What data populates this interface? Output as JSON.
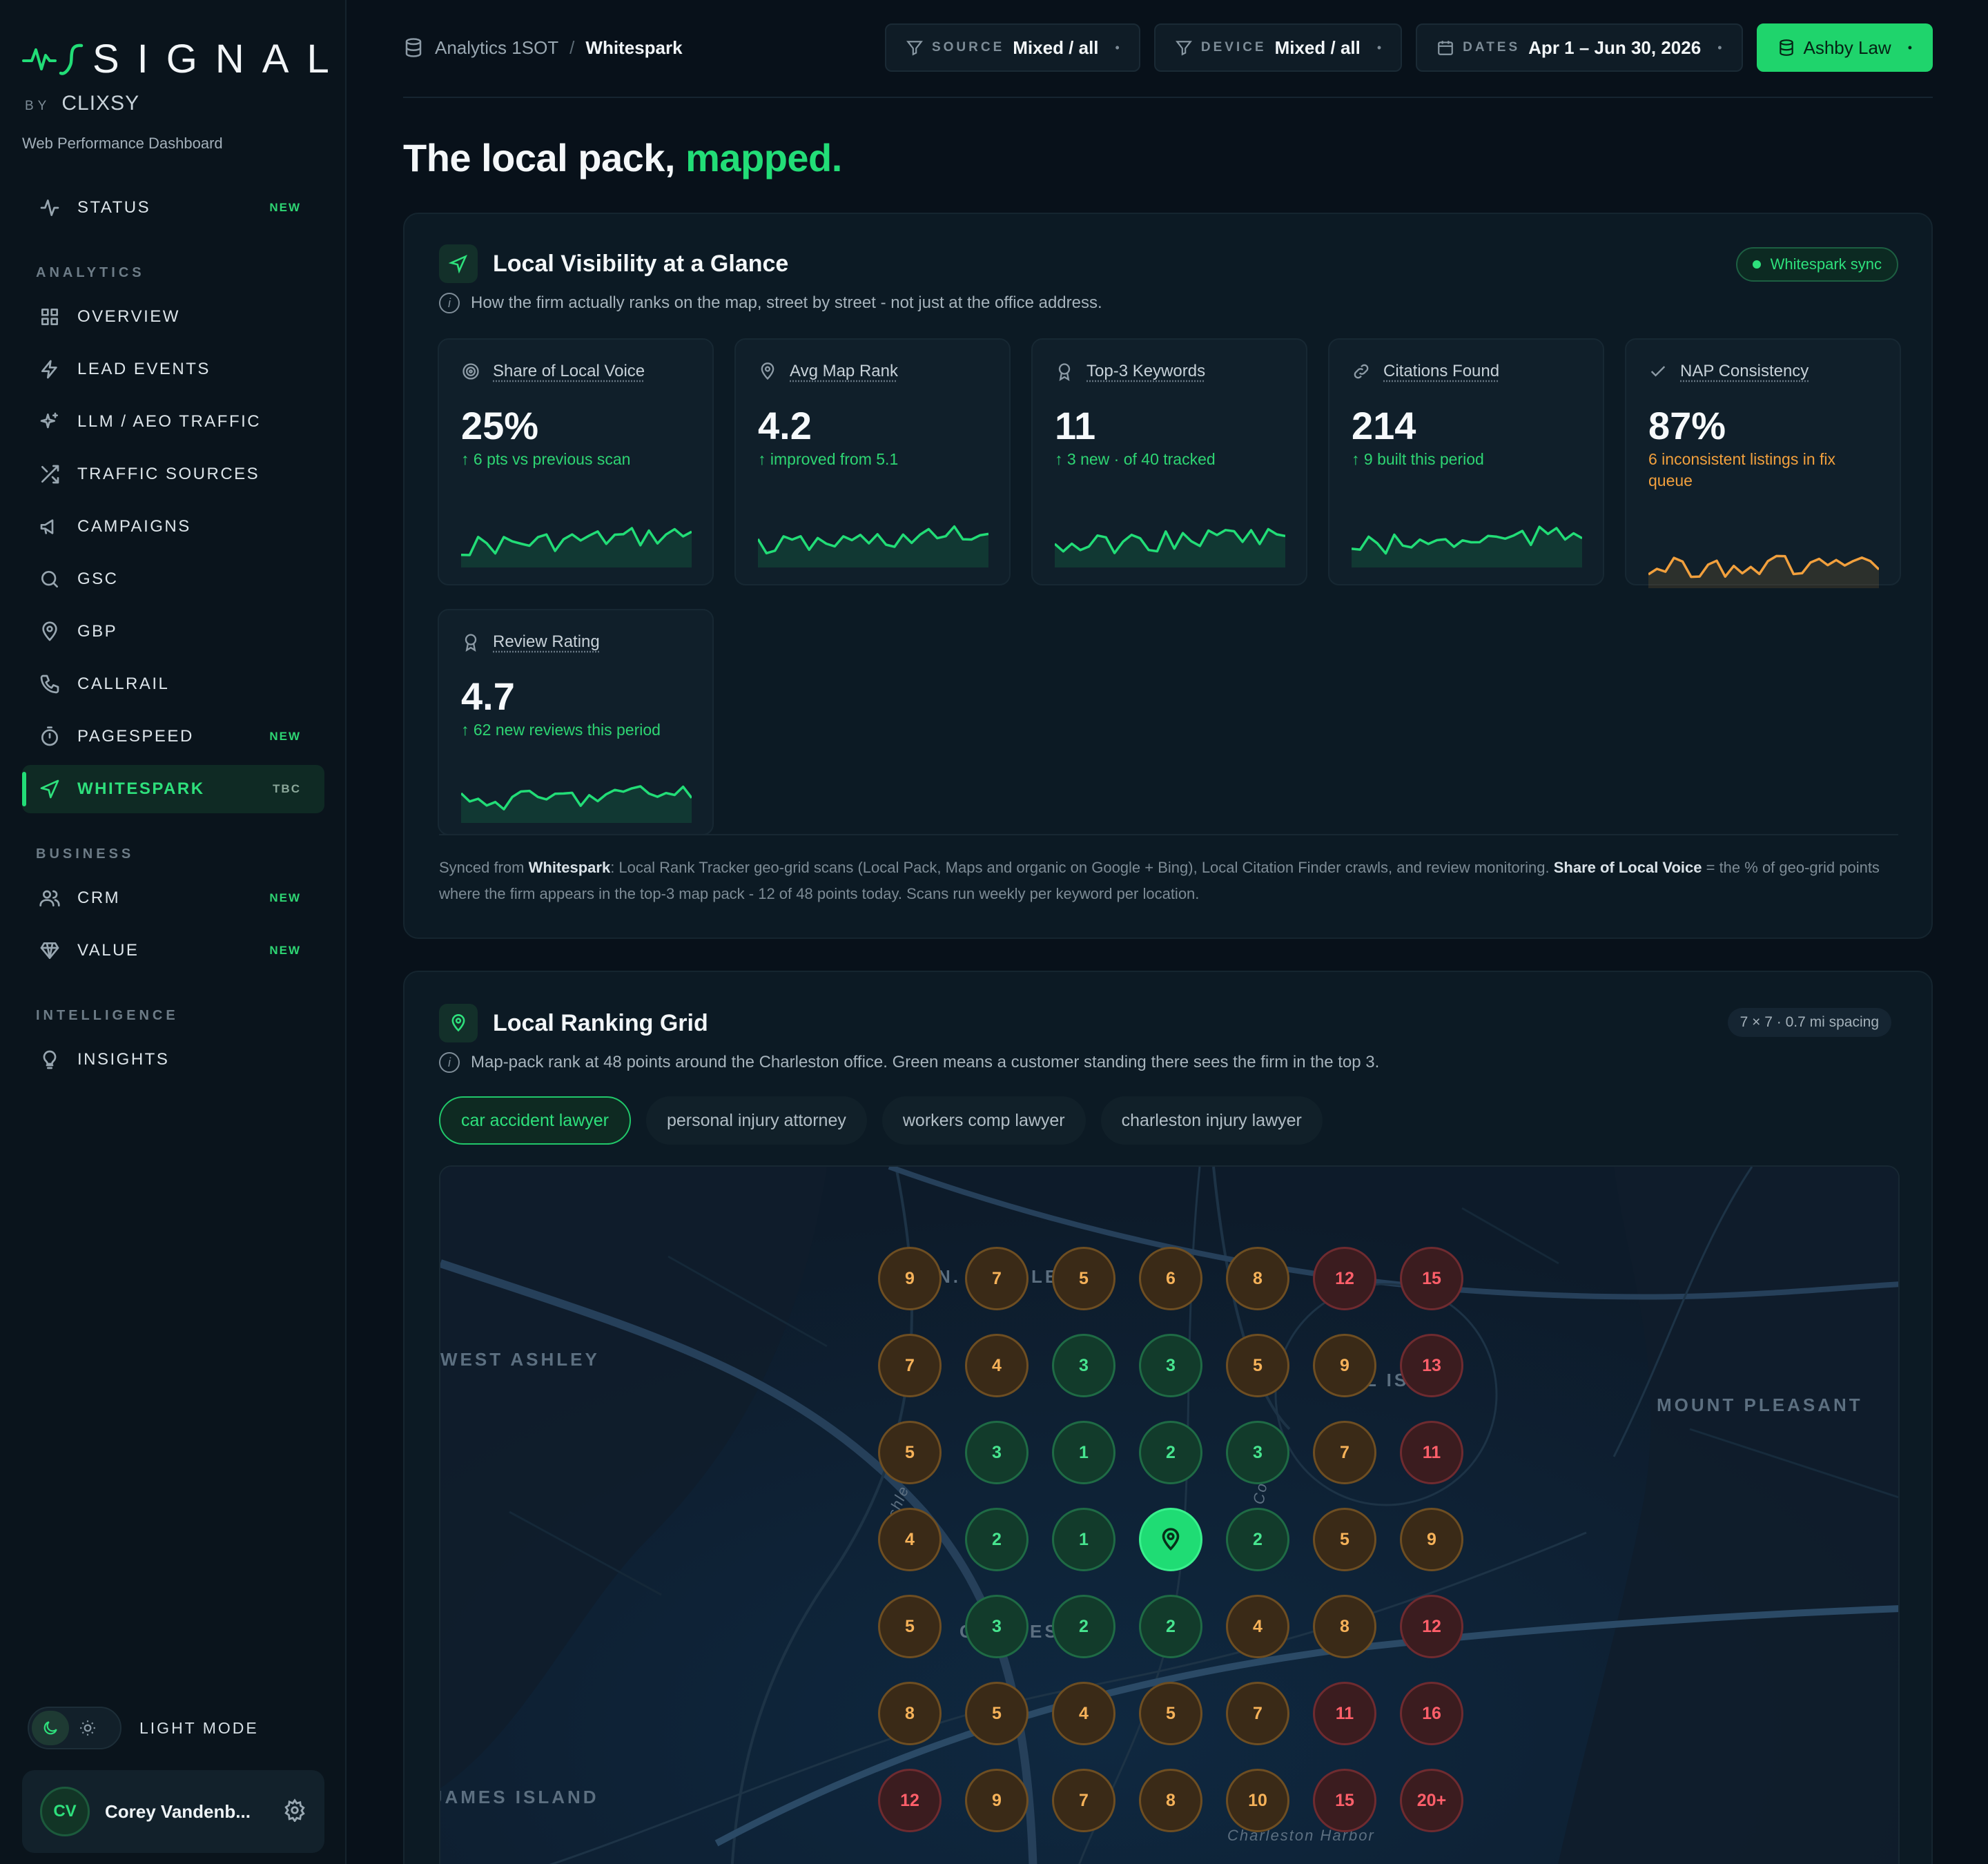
{
  "sidebar": {
    "brand": "SIGNAL",
    "by": "BY",
    "brand_by": "CLIXSY",
    "subtitle": "Web Performance Dashboard",
    "status": {
      "label": "STATUS",
      "badge": "NEW"
    },
    "groups": [
      "ANALYTICS",
      "BUSINESS",
      "INTELLIGENCE"
    ],
    "analytics": [
      {
        "label": "OVERVIEW",
        "icon": "grid-icon"
      },
      {
        "label": "LEAD EVENTS",
        "icon": "bolt-icon"
      },
      {
        "label": "LLM / AEO TRAFFIC",
        "icon": "sparkle-icon"
      },
      {
        "label": "TRAFFIC SOURCES",
        "icon": "shuffle-icon"
      },
      {
        "label": "CAMPAIGNS",
        "icon": "megaphone-icon"
      },
      {
        "label": "GSC",
        "icon": "search-icon"
      },
      {
        "label": "GBP",
        "icon": "map-pin-icon"
      },
      {
        "label": "CALLRAIL",
        "icon": "phone-icon"
      },
      {
        "label": "PAGESPEED",
        "icon": "timer-icon",
        "badge": "NEW"
      },
      {
        "label": "WHITESPARK",
        "icon": "navigation-icon",
        "badge": "TBC"
      }
    ],
    "business": [
      {
        "label": "CRM",
        "icon": "users-icon",
        "badge": "NEW"
      },
      {
        "label": "VALUE",
        "icon": "diamond-icon",
        "badge": "NEW"
      }
    ],
    "intelligence": [
      {
        "label": "INSIGHTS",
        "icon": "lightbulb-icon"
      }
    ],
    "theme_label": "LIGHT MODE",
    "user": {
      "initials": "CV",
      "name": "Corey Vandenb..."
    }
  },
  "topbar": {
    "crumb_parent": "Analytics 1SOT",
    "crumb_sep": "/",
    "crumb_current": "Whitespark",
    "filters": [
      {
        "label": "SOURCE",
        "value": "Mixed / all"
      },
      {
        "label": "DEVICE",
        "value": "Mixed / all"
      },
      {
        "label": "DATES",
        "value": "Apr 1 – Jun 30, 2026"
      }
    ],
    "client": "Ashby Law"
  },
  "headline": {
    "main": "The local pack,",
    "accent": "mapped."
  },
  "visibility": {
    "title": "Local Visibility at a Glance",
    "subtitle": "How the firm actually ranks on the map, street by street - not just at the office address.",
    "badge": "Whitespark sync",
    "kpis": [
      {
        "label": "Share of Local Voice",
        "value": "25%",
        "delta": "↑ 6 pts vs previous scan",
        "trend": "up",
        "icon": "target-icon"
      },
      {
        "label": "Avg Map Rank",
        "value": "4.2",
        "delta": "↑ improved from 5.1",
        "trend": "up",
        "icon": "map-pin-icon"
      },
      {
        "label": "Top-3 Keywords",
        "value": "11",
        "delta": "↑ 3 new · of 40 tracked",
        "trend": "up",
        "icon": "award-icon"
      },
      {
        "label": "Citations Found",
        "value": "214",
        "delta": "↑ 9 built this period",
        "trend": "up",
        "icon": "link-icon"
      },
      {
        "label": "NAP Consistency",
        "value": "87%",
        "delta": "6 inconsistent listings in fix queue",
        "trend": "warn",
        "icon": "check-icon"
      },
      {
        "label": "Review Rating",
        "value": "4.7",
        "delta": "↑ 62 new reviews this period",
        "trend": "up",
        "icon": "award-icon"
      }
    ],
    "note": {
      "p1": "Synced from ",
      "b1": "Whitespark",
      "p2": ": Local Rank Tracker geo-grid scans (Local Pack, Maps and organic on Google + Bing), Local Citation Finder crawls, and review monitoring. ",
      "b2": "Share of Local Voice",
      "p3": " = the % of geo-grid points where the firm appears in the top-3 map pack - 12 of 48 points today. Scans run weekly per keyword per location."
    },
    "colors": {
      "up": "#22dd77",
      "warn": "#f2a03d"
    }
  },
  "ranking_grid": {
    "title": "Local Ranking Grid",
    "subtitle": "Map-pack rank at 48 points around the Charleston office. Green means a customer standing there sees the firm in the top 3.",
    "badge": "7 × 7 · 0.7 mi spacing",
    "tabs": [
      "car accident lawyer",
      "personal injury attorney",
      "workers comp lawyer",
      "charleston injury lawyer"
    ],
    "active_tab": 0,
    "map_labels": {
      "west": "WEST ASHLEY",
      "east": "MOUNT PLEASANT",
      "sw": "JAMES ISLAND",
      "harbor": "Charleston Harbor",
      "n": "N.",
      "le": "LE",
      "island": "L IS",
      "ches": "C",
      "es": "ES",
      "ashley": "Ashle",
      "cooper": "Co"
    },
    "grid": [
      [
        "9",
        "7",
        "5",
        "6",
        "8",
        "12",
        "15"
      ],
      [
        "7",
        "4",
        "3",
        "3",
        "5",
        "9",
        "13"
      ],
      [
        "5",
        "3",
        "1",
        "2",
        "3",
        "7",
        "11"
      ],
      [
        "4",
        "2",
        "1",
        "office",
        "2",
        "5",
        "9"
      ],
      [
        "5",
        "3",
        "2",
        "2",
        "4",
        "8",
        "12"
      ],
      [
        "8",
        "5",
        "4",
        "5",
        "7",
        "11",
        "16"
      ],
      [
        "12",
        "9",
        "7",
        "8",
        "10",
        "15",
        "20+"
      ]
    ],
    "colors": {
      "top3": "#47e58f",
      "mid": "#f6b259",
      "low": "#ff5f6a"
    }
  }
}
